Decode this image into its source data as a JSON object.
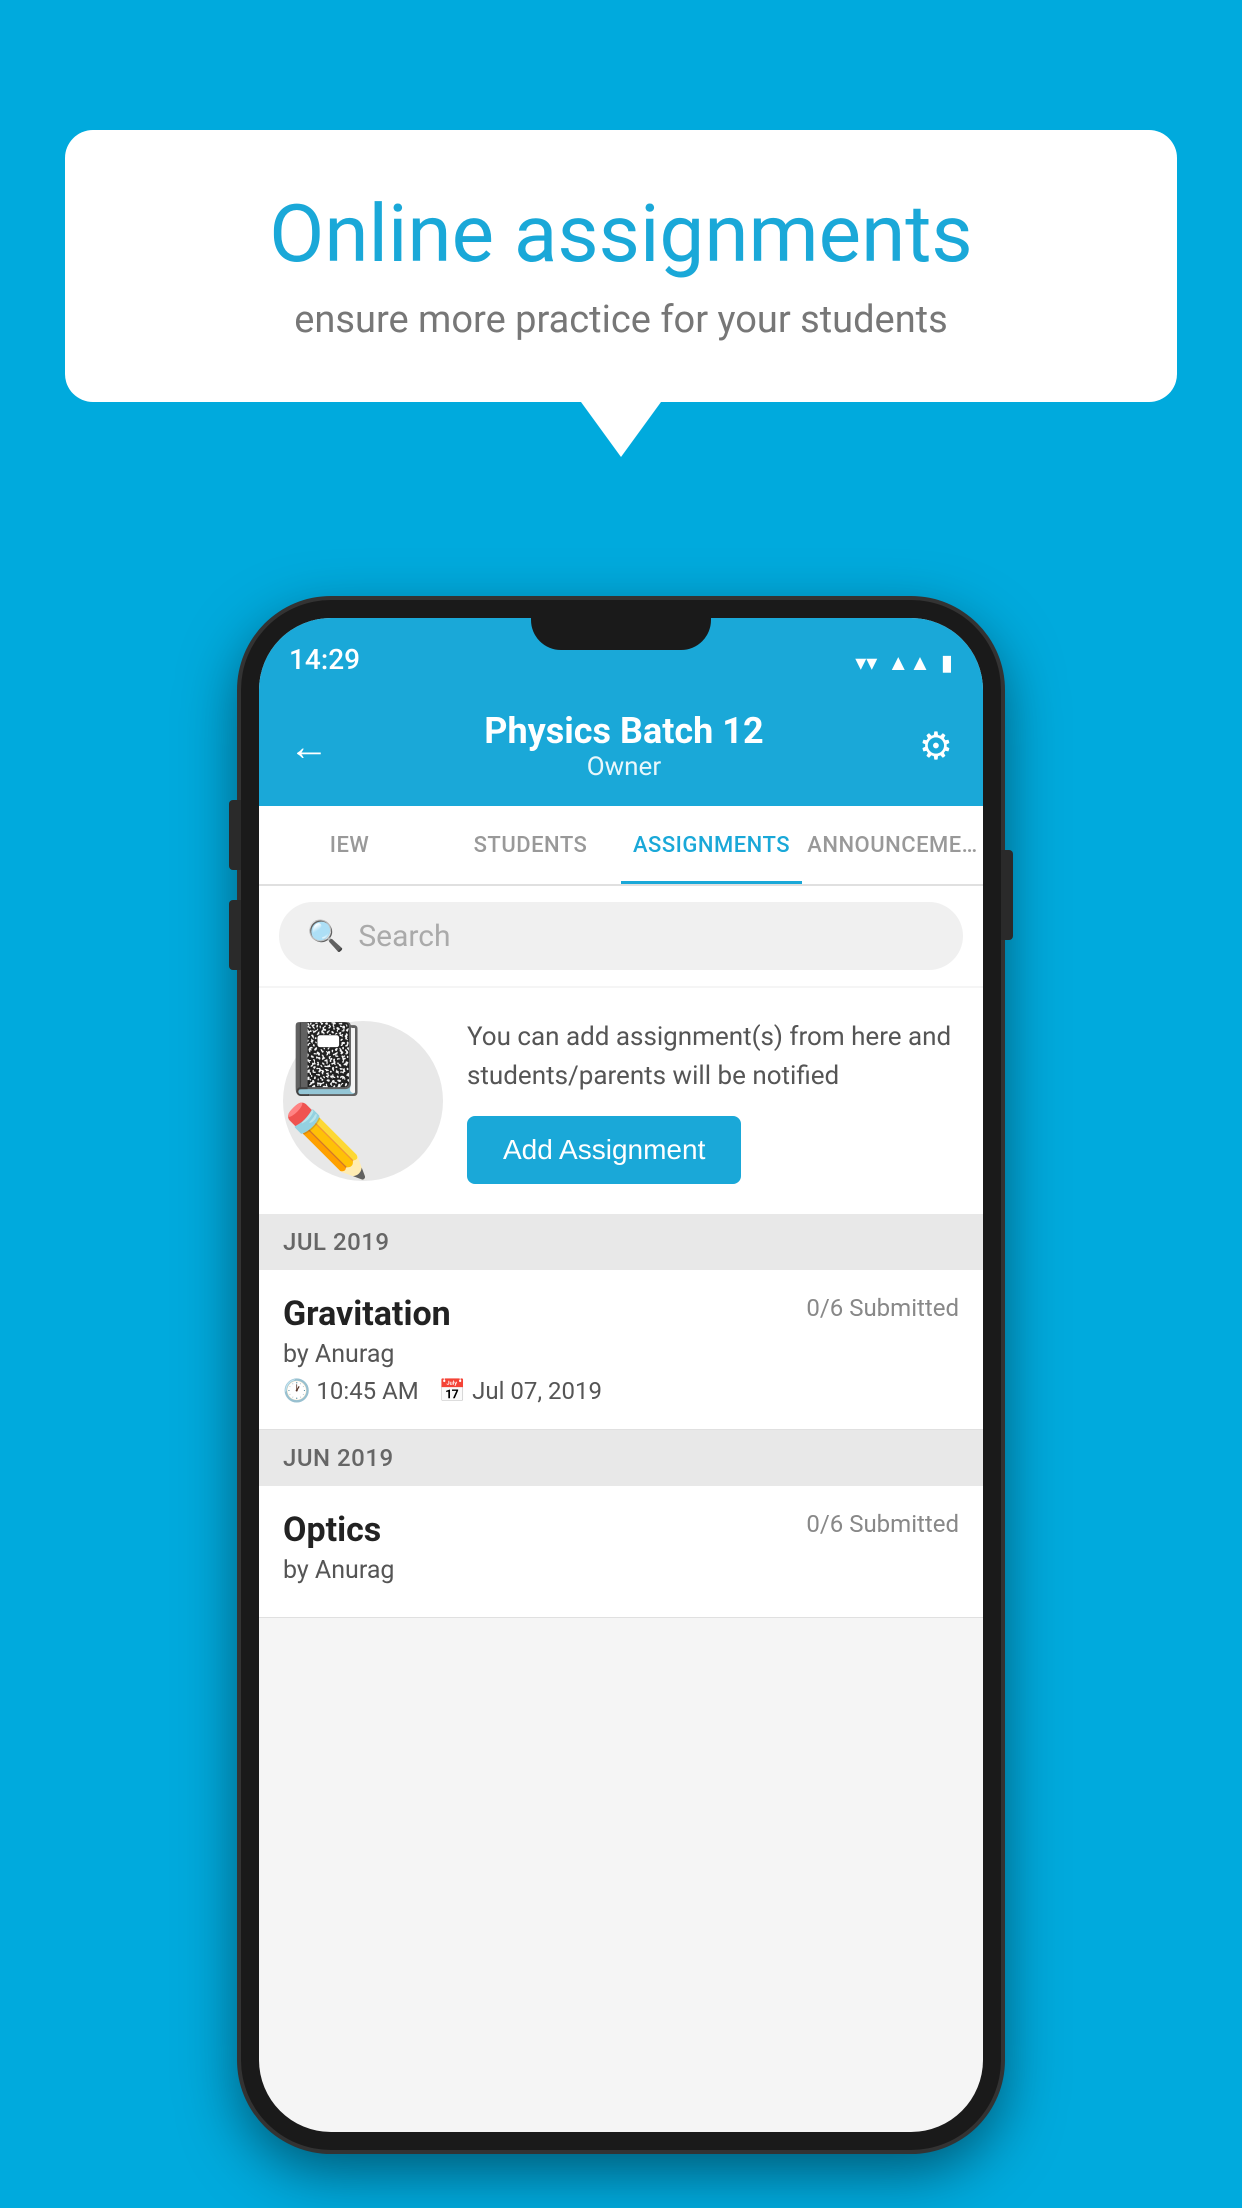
{
  "background_color": "#00AADD",
  "speech_bubble": {
    "title": "Online assignments",
    "subtitle": "ensure more practice for your students"
  },
  "status_bar": {
    "time": "14:29",
    "icons": [
      "wifi",
      "signal",
      "battery"
    ]
  },
  "app_bar": {
    "back_label": "←",
    "title": "Physics Batch 12",
    "subtitle": "Owner",
    "settings_label": "⚙"
  },
  "tabs": [
    {
      "label": "IEW",
      "active": false
    },
    {
      "label": "STUDENTS",
      "active": false
    },
    {
      "label": "ASSIGNMENTS",
      "active": true
    },
    {
      "label": "ANNOUNCEME…",
      "active": false
    }
  ],
  "search": {
    "placeholder": "Search"
  },
  "promo": {
    "description": "You can add assignment(s) from here and students/parents will be notified",
    "button_label": "Add Assignment"
  },
  "sections": [
    {
      "header": "JUL 2019",
      "assignments": [
        {
          "title": "Gravitation",
          "submitted": "0/6 Submitted",
          "author": "by Anurag",
          "time": "10:45 AM",
          "date": "Jul 07, 2019"
        }
      ]
    },
    {
      "header": "JUN 2019",
      "assignments": [
        {
          "title": "Optics",
          "submitted": "0/6 Submitted",
          "author": "by Anurag",
          "time": "",
          "date": ""
        }
      ]
    }
  ]
}
